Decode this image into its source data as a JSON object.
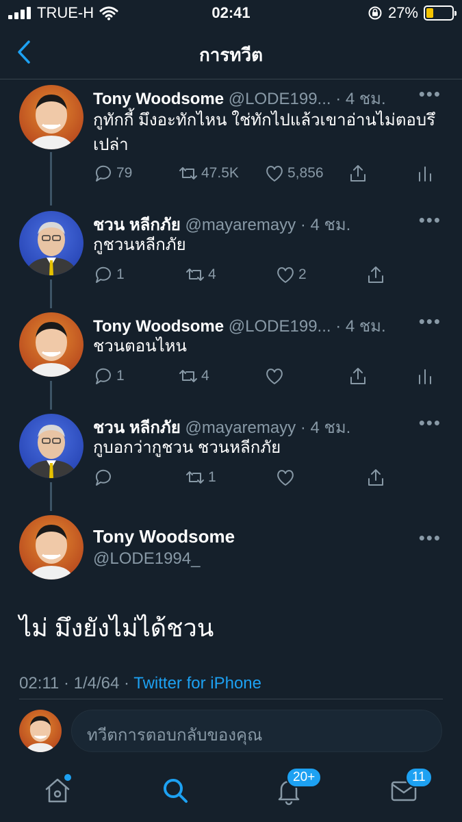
{
  "status_bar": {
    "carrier": "TRUE-H",
    "time": "02:41",
    "battery_percent": "27%",
    "battery_level": 0.27,
    "battery_color": "#f5c400"
  },
  "nav": {
    "title": "การทวีต"
  },
  "tweets": [
    {
      "name": "Tony Woodsome",
      "handle": "@LODE199...",
      "time": "· 4 ชม.",
      "text": "กูทักกี้ มึงอะทักไหน ใช่ทักไปแล้วเขาอ่านไม่ตอบรึเปล่า",
      "replies": "79",
      "retweets": "47.5K",
      "likes": "5,856"
    },
    {
      "name": "ชวน หลีกภัย",
      "handle": "@mayaremayy",
      "time": "· 4 ชม.",
      "text": "กูชวนหลีกภัย",
      "replies": "1",
      "retweets": "4",
      "likes": "2"
    },
    {
      "name": "Tony Woodsome",
      "handle": "@LODE199...",
      "time": "· 4 ชม.",
      "text": "ชวนตอนไหน",
      "replies": "1",
      "retweets": "4",
      "likes": ""
    },
    {
      "name": "ชวน หลีกภัย",
      "handle": "@mayaremayy",
      "time": "· 4 ชม.",
      "text": "กูบอกว่ากูชวน ชวนหลีกภัย",
      "replies": "",
      "retweets": "1",
      "likes": ""
    }
  ],
  "main_tweet": {
    "name": "Tony Woodsome",
    "handle": "@LODE1994_",
    "text": "ไม่ มึงยังไม่ได้ชวน",
    "time": "02:11 · 1/4/64 · ",
    "source": "Twitter for iPhone"
  },
  "reply": {
    "placeholder": "ทวีตการตอบกลับของคุณ"
  },
  "tab_bar": {
    "notifications_badge": "20+",
    "messages_badge": "11",
    "accent": "#1da1f2"
  }
}
